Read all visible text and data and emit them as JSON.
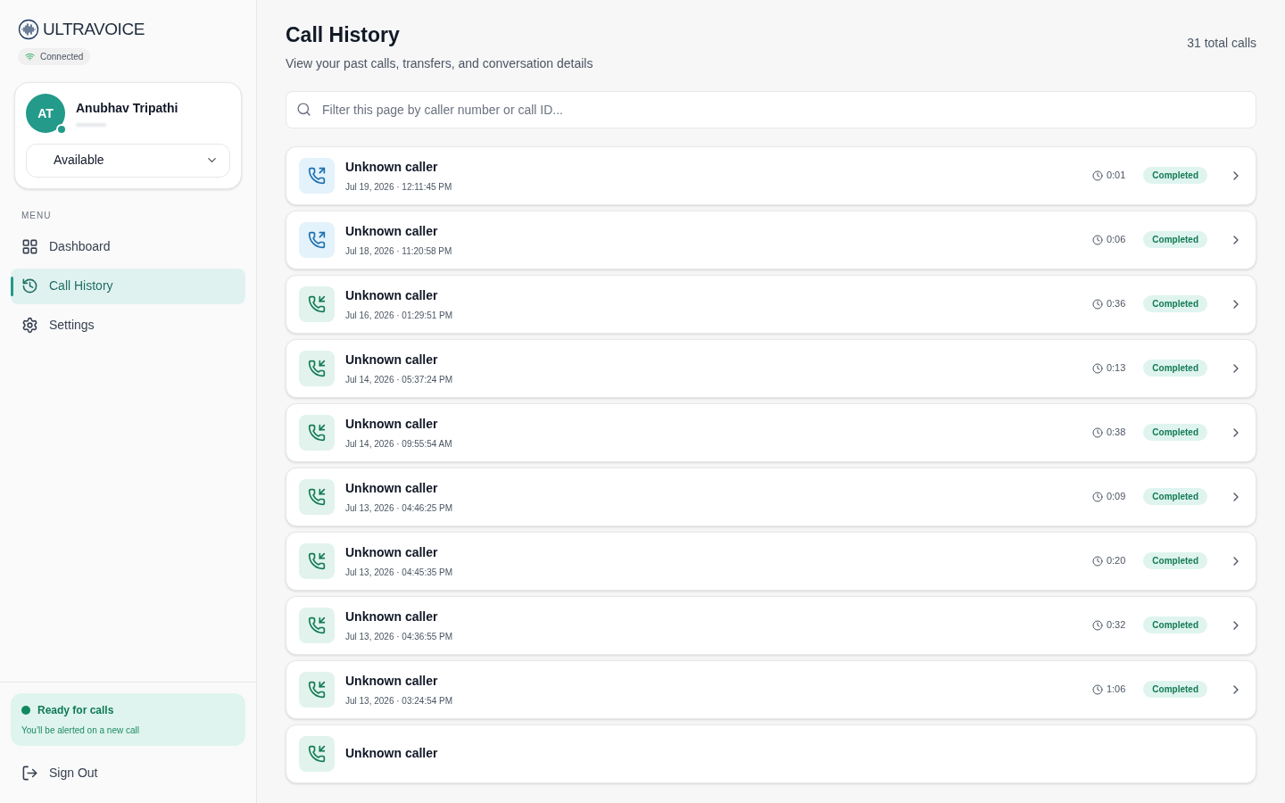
{
  "brand": {
    "name": "ULTRAVOICE",
    "status": "Connected"
  },
  "user": {
    "initials": "AT",
    "name": "Anubhav Tripathi",
    "availability": "Available"
  },
  "menu": {
    "heading": "MENU",
    "items": [
      {
        "label": "Dashboard",
        "selected": false
      },
      {
        "label": "Call History",
        "selected": true
      },
      {
        "label": "Settings",
        "selected": false
      }
    ]
  },
  "ready": {
    "title": "Ready for calls",
    "text": "You’ll be alerted on a new call"
  },
  "sign_out": "Sign Out",
  "page": {
    "title": "Call History",
    "subtitle": "View your past calls, transfers, and conversation details",
    "total": "31 total calls"
  },
  "search": {
    "placeholder": "Filter this page by caller number or call ID..."
  },
  "calls": [
    {
      "kind": "outgoing",
      "caller": "Unknown caller",
      "time": "Jul 19, 2026 · 12:11:45 PM",
      "duration": "0:01",
      "status": "Completed"
    },
    {
      "kind": "outgoing",
      "caller": "Unknown caller",
      "time": "Jul 18, 2026 · 11:20:58 PM",
      "duration": "0:06",
      "status": "Completed"
    },
    {
      "kind": "incoming",
      "caller": "Unknown caller",
      "time": "Jul 16, 2026 · 01:29:51 PM",
      "duration": "0:36",
      "status": "Completed"
    },
    {
      "kind": "incoming",
      "caller": "Unknown caller",
      "time": "Jul 14, 2026 · 05:37:24 PM",
      "duration": "0:13",
      "status": "Completed"
    },
    {
      "kind": "incoming",
      "caller": "Unknown caller",
      "time": "Jul 14, 2026 · 09:55:54 AM",
      "duration": "0:38",
      "status": "Completed"
    },
    {
      "kind": "incoming",
      "caller": "Unknown caller",
      "time": "Jul 13, 2026 · 04:46:25 PM",
      "duration": "0:09",
      "status": "Completed"
    },
    {
      "kind": "incoming",
      "caller": "Unknown caller",
      "time": "Jul 13, 2026 · 04:45:35 PM",
      "duration": "0:20",
      "status": "Completed"
    },
    {
      "kind": "incoming",
      "caller": "Unknown caller",
      "time": "Jul 13, 2026 · 04:36:55 PM",
      "duration": "0:32",
      "status": "Completed"
    },
    {
      "kind": "incoming",
      "caller": "Unknown caller",
      "time": "Jul 13, 2026 · 03:24:54 PM",
      "duration": "1:06",
      "status": "Completed"
    },
    {
      "kind": "incoming",
      "caller": "Unknown caller"
    }
  ]
}
